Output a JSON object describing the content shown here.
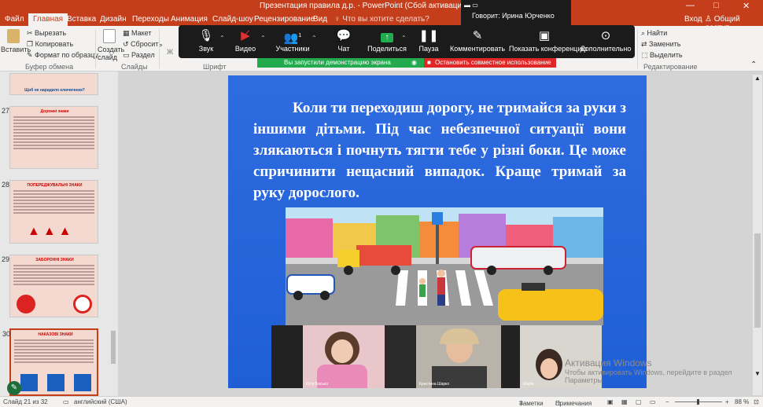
{
  "titlebar": {
    "title": "Презентация правила д.р. - PowerPoint (Сбой активации прод",
    "controls": [
      "—",
      "□",
      "✕"
    ]
  },
  "menu": {
    "tabs": [
      "Файл",
      "Главная",
      "Вставка",
      "Дизайн",
      "Переходы",
      "Анимация",
      "Слайд-шоу",
      "Рецензирование",
      "Вид"
    ],
    "active_tab": "Главная",
    "tell_me": "Что вы хотите сделать?",
    "login": "Вход",
    "share": "Общий доступ"
  },
  "ribbon": {
    "paste": "Вставить",
    "cut": "Вырезать",
    "copy": "Копировать",
    "format_painter": "Формат по образцу",
    "clipboard_group": "Буфер обмена",
    "new_slide": "Создать слайд",
    "layout": "Макет",
    "reset": "Сбросить",
    "section": "Раздел",
    "slides_group": "Слайды",
    "font_group": "Шрифт",
    "find": "Найти",
    "replace": "Заменить",
    "select": "Выделить",
    "editing_group": "Редактирование"
  },
  "zoom": {
    "speaking": "Говорит: Ирина Юрченко",
    "buttons": [
      {
        "label": "Звук",
        "icon": "microphone-icon"
      },
      {
        "label": "Видео",
        "icon": "video-off-icon"
      },
      {
        "label": "Участники",
        "icon": "participants-icon",
        "badge": "1"
      },
      {
        "label": "Чат",
        "icon": "chat-icon"
      },
      {
        "label": "Поделиться",
        "icon": "share-screen-icon"
      },
      {
        "label": "Пауза",
        "icon": "pause-icon"
      },
      {
        "label": "Комментировать",
        "icon": "annotate-icon"
      },
      {
        "label": "Показать конференцию",
        "icon": "show-meeting-icon"
      },
      {
        "label": "Дополнительно",
        "icon": "more-icon"
      }
    ],
    "share_notice": "Вы запустили демонстрацию экрана",
    "stop_share": "Остановить совместное использование"
  },
  "thumbnails": [
    {
      "number": "",
      "title": "Щоб не нарадило ключичном?",
      "bg": "#cfe6f7"
    },
    {
      "number": "27",
      "title": "Дорожні знаки",
      "bg": "#f4d9d0"
    },
    {
      "number": "28",
      "title": "ПОПЕРЕДЖУВАЛЬНІ ЗНАКИ",
      "bg": "#f4d9d0"
    },
    {
      "number": "29",
      "title": "ЗАБОРОННІ ЗНАКИ",
      "bg": "#f4d9d0"
    },
    {
      "number": "30",
      "title": "НАКАЗОВІ ЗНАКИ",
      "bg": "#f4d9d0"
    }
  ],
  "slide": {
    "text": "Коли ти переходиш дорогу, не тримайся за руки з іншими дітьми. Під час небезпечної ситуації вони злякаються і почнуть тягти тебе у різні боки. Це може спричинити нещасний випадок. Краще тримай за руку дорослого."
  },
  "videos": [
    {
      "name": "Юля Басько"
    },
    {
      "name": "Кристина Шарко"
    },
    {
      "name": "Марія"
    }
  ],
  "watermark": {
    "line1": "Активация Windows",
    "line2": "Чтобы активировать Windows, перейдите в раздел",
    "line3": "Параметры"
  },
  "status": {
    "slide": "Слайд 21 из 32",
    "language": "английский (США)",
    "notes": "Заметки",
    "comments": "Примечания",
    "zoom": "88 %"
  },
  "colors": {
    "accent": "#c43e1c",
    "slide_bg": "#2563dc",
    "zoom_bar": "#1b1b1b",
    "share_green": "#23a94e",
    "stop_red": "#e02727"
  }
}
